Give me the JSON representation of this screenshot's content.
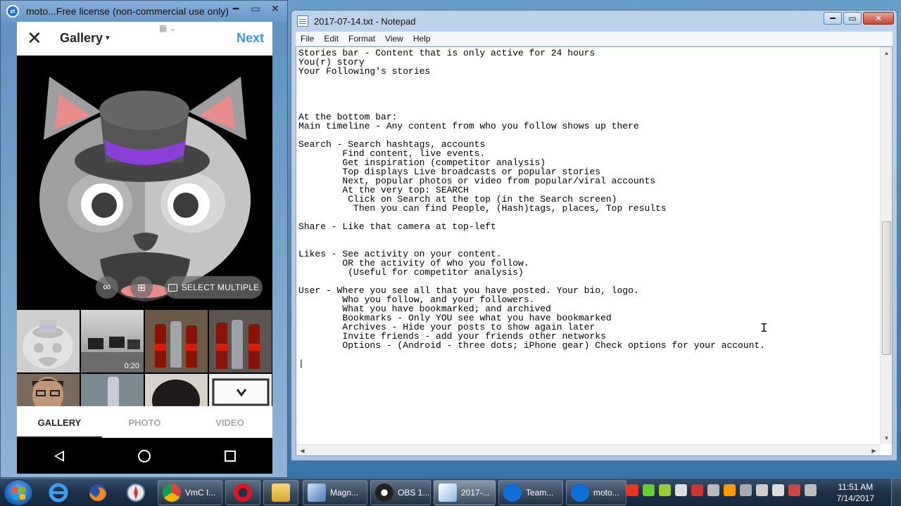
{
  "phone_window": {
    "title": "moto...Free license (non-commercial use only)",
    "app_header": {
      "title": "Gallery",
      "next_label": "Next"
    },
    "preview_buttons": {
      "select_multiple": "SELECT MULTIPLE"
    },
    "thumbnails": [
      {
        "duration": ""
      },
      {
        "duration": "0:20"
      },
      {
        "duration": ""
      },
      {
        "duration": ""
      },
      {
        "duration": ""
      },
      {
        "duration": ""
      },
      {
        "duration": ""
      },
      {
        "duration": ""
      }
    ],
    "tabs": [
      "GALLERY",
      "PHOTO",
      "VIDEO"
    ],
    "active_tab": "GALLERY"
  },
  "notepad": {
    "title": "2017-07-14.txt - Notepad",
    "menu": [
      "File",
      "Edit",
      "Format",
      "View",
      "Help"
    ],
    "text": "Stories bar - Content that is only active for 24 hours\nYou(r) story\nYour Following's stories\n\n\n\n\nAt the bottom bar:\nMain timeline - Any content from who you follow shows up there\n\nSearch - Search hashtags, accounts\n        Find content, live events.\n        Get inspiration (competitor analysis)\n        Top displays Live broadcasts or popular stories\n        Next, popular photos or video from popular/viral accounts\n        At the very top: SEARCH\n         Click on Search at the top (in the Search screen)\n          Then you can find People, (Hash)tags, places, Top results\n\nShare - Like that camera at top-left\n\n\nLikes - See activity on your content.\n        OR the activity of who you follow.\n         (Useful for competitor analysis)\n\nUser - Where you see all that you have posted. Your bio, logo.\n        Who you follow, and your followers.\n        What you have bookmarked; and archived\n        Bookmarks - Only YOU see what you have bookmarked\n        Archives - Hide your posts to show again later\n        Invite friends - add your friends other networks\n        Options - (Android - three dots; iPhone gear) Check options for your account.\n\n|"
  },
  "taskbar": {
    "buttons": [
      {
        "label": "VmC I...",
        "icon": "chrome-icon"
      },
      {
        "label": "",
        "icon": "opera-icon"
      },
      {
        "label": "",
        "icon": "folder-icon"
      },
      {
        "label": "Magn...",
        "icon": "magnifier-icon"
      },
      {
        "label": "OBS 1...",
        "icon": "obs-icon"
      },
      {
        "label": "2017-...",
        "icon": "notepad-icon"
      },
      {
        "label": "Team...",
        "icon": "teamviewer-icon"
      },
      {
        "label": "moto...",
        "icon": "teamviewer-icon"
      }
    ],
    "clock_time": "11:51 AM",
    "clock_date": "7/14/2017"
  },
  "colors": {
    "instagram_blue": "#3897f0",
    "hat_band": "#8a3fd6"
  }
}
